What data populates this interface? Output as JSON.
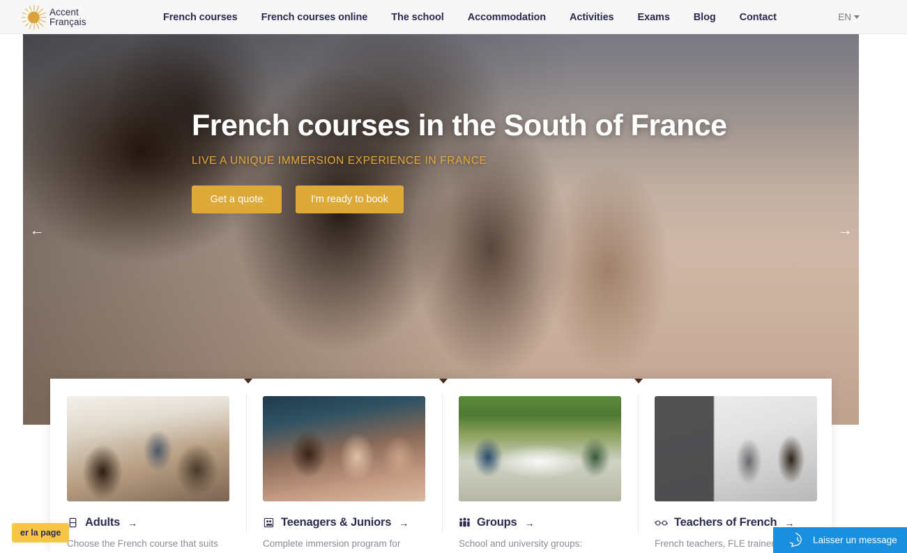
{
  "header": {
    "logo": {
      "icon": "sun-logo-icon",
      "line1": "Accent",
      "line2": "Français"
    },
    "nav": [
      {
        "label": "French courses"
      },
      {
        "label": "French courses online"
      },
      {
        "label": "The school"
      },
      {
        "label": "Accommodation"
      },
      {
        "label": "Activities"
      },
      {
        "label": "Exams"
      },
      {
        "label": "Blog"
      },
      {
        "label": "Contact"
      }
    ],
    "language": {
      "label": "EN",
      "icon": "chevron-down-icon"
    }
  },
  "hero": {
    "title": "French courses in the South of France",
    "subtitle": "LIVE A UNIQUE IMMERSION EXPERIENCE IN FRANCE",
    "buttons": [
      {
        "label": "Get a quote"
      },
      {
        "label": "I'm ready to book"
      }
    ],
    "prev_icon": "arrow-left-icon",
    "next_icon": "arrow-right-icon",
    "prev_glyph": "←",
    "next_glyph": "→"
  },
  "cards": [
    {
      "icon": "adult-person-icon",
      "title": "Adults",
      "arrow": "→",
      "description": "Choose the French course that suits"
    },
    {
      "icon": "teenagers-icon",
      "title": "Teenagers & Juniors",
      "arrow": "→",
      "description": "Complete immersion program for"
    },
    {
      "icon": "group-people-icon",
      "title": "Groups",
      "arrow": "→",
      "description": "School and university groups:"
    },
    {
      "icon": "glasses-icon",
      "title": "Teachers of French",
      "arrow": "→",
      "description": "French teachers, FLE trainers"
    }
  ],
  "widgets": {
    "share_button": {
      "label": "er la page"
    },
    "chat": {
      "icon": "chat-clock-icon",
      "label": "Laisser un message"
    }
  },
  "colors": {
    "accent_gold": "#dda938",
    "subtitle_gold": "#e3a83a",
    "navy": "#2b2b50",
    "chat_blue": "#1a8fe0",
    "share_yellow": "#f7c548"
  }
}
